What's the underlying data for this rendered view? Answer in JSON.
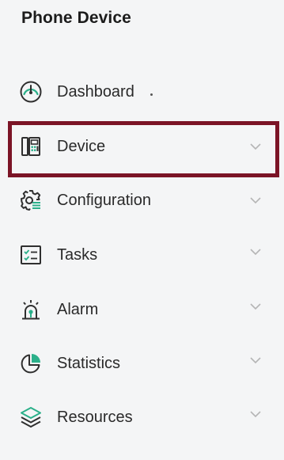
{
  "header": {
    "title": "Phone Device"
  },
  "menu": {
    "items": [
      {
        "key": "dashboard",
        "label": "Dashboard",
        "icon": "dashboard-gauge-icon",
        "has_chevron": false,
        "selected": false
      },
      {
        "key": "device",
        "label": "Device",
        "icon": "device-phone-icon",
        "has_chevron": true,
        "selected": true
      },
      {
        "key": "configuration",
        "label": "Configuration",
        "icon": "configuration-gear-icon",
        "has_chevron": true,
        "selected": false
      },
      {
        "key": "tasks",
        "label": "Tasks",
        "icon": "tasks-checklist-icon",
        "has_chevron": true,
        "selected": false
      },
      {
        "key": "alarm",
        "label": "Alarm",
        "icon": "alarm-siren-icon",
        "has_chevron": true,
        "selected": false
      },
      {
        "key": "statistics",
        "label": "Statistics",
        "icon": "statistics-pie-icon",
        "has_chevron": true,
        "selected": false
      },
      {
        "key": "resources",
        "label": "Resources",
        "icon": "resources-layers-icon",
        "has_chevron": true,
        "selected": false
      }
    ]
  },
  "colors": {
    "icon_dark": "#2f2f2f",
    "icon_accent": "#2bb08a",
    "selection_border": "#7b1426",
    "chevron": "#b5b5b5",
    "background": "#f4f5f6"
  }
}
